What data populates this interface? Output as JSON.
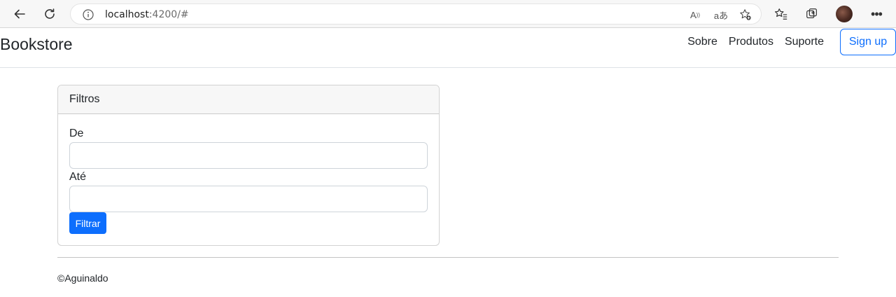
{
  "browser": {
    "url_host": "localhost",
    "url_path": ":4200/#",
    "read_aloud_icon": "read-aloud-icon",
    "translate_icon": "translate-icon",
    "favorite_icon": "add-favorite-icon"
  },
  "navbar": {
    "brand": "Bookstore",
    "links": [
      "Sobre",
      "Produtos",
      "Suporte"
    ],
    "signup": "Sign up"
  },
  "filters": {
    "title": "Filtros",
    "from_label": "De",
    "from_value": "",
    "to_label": "Até",
    "to_value": "",
    "submit": "Filtrar"
  },
  "footer": {
    "text": "©Aguinaldo"
  },
  "colors": {
    "primary": "#0d6efd",
    "card_header_bg": "#f7f7f7"
  }
}
